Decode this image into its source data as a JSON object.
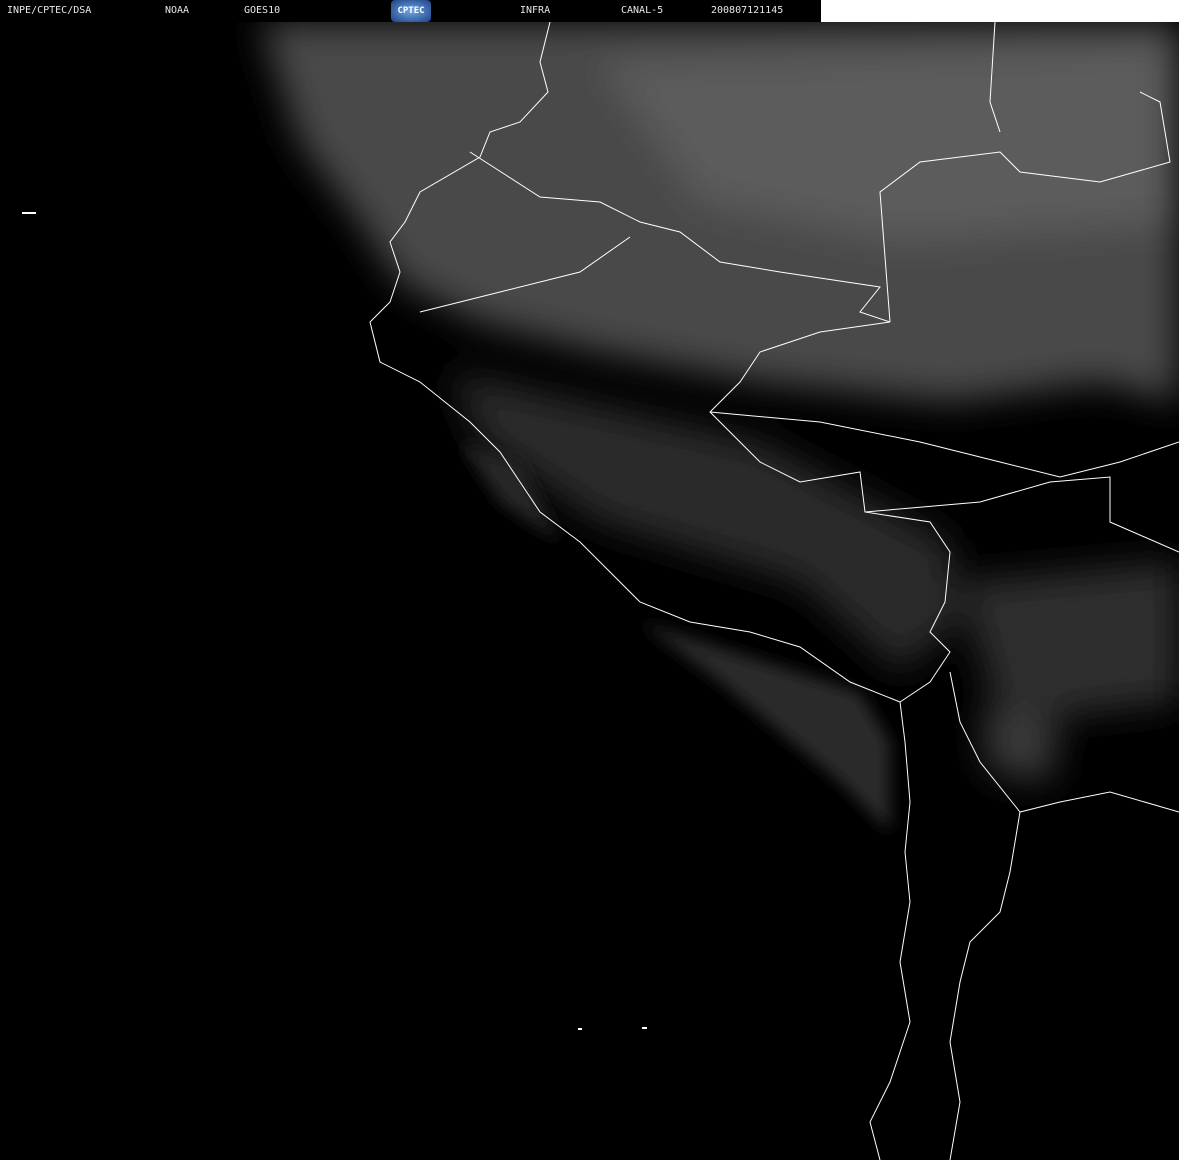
{
  "header": {
    "institution": "INPE/CPTEC/DSA",
    "agency": "NOAA",
    "satellite": "GOES10",
    "logo_text": "CPTEC",
    "product": "INFRA",
    "channel": "CANAL-5",
    "timestamp": "200807121145"
  },
  "colors": {
    "border": "#ffffff",
    "cloud": "#5a5a5a",
    "background": "#000000"
  }
}
